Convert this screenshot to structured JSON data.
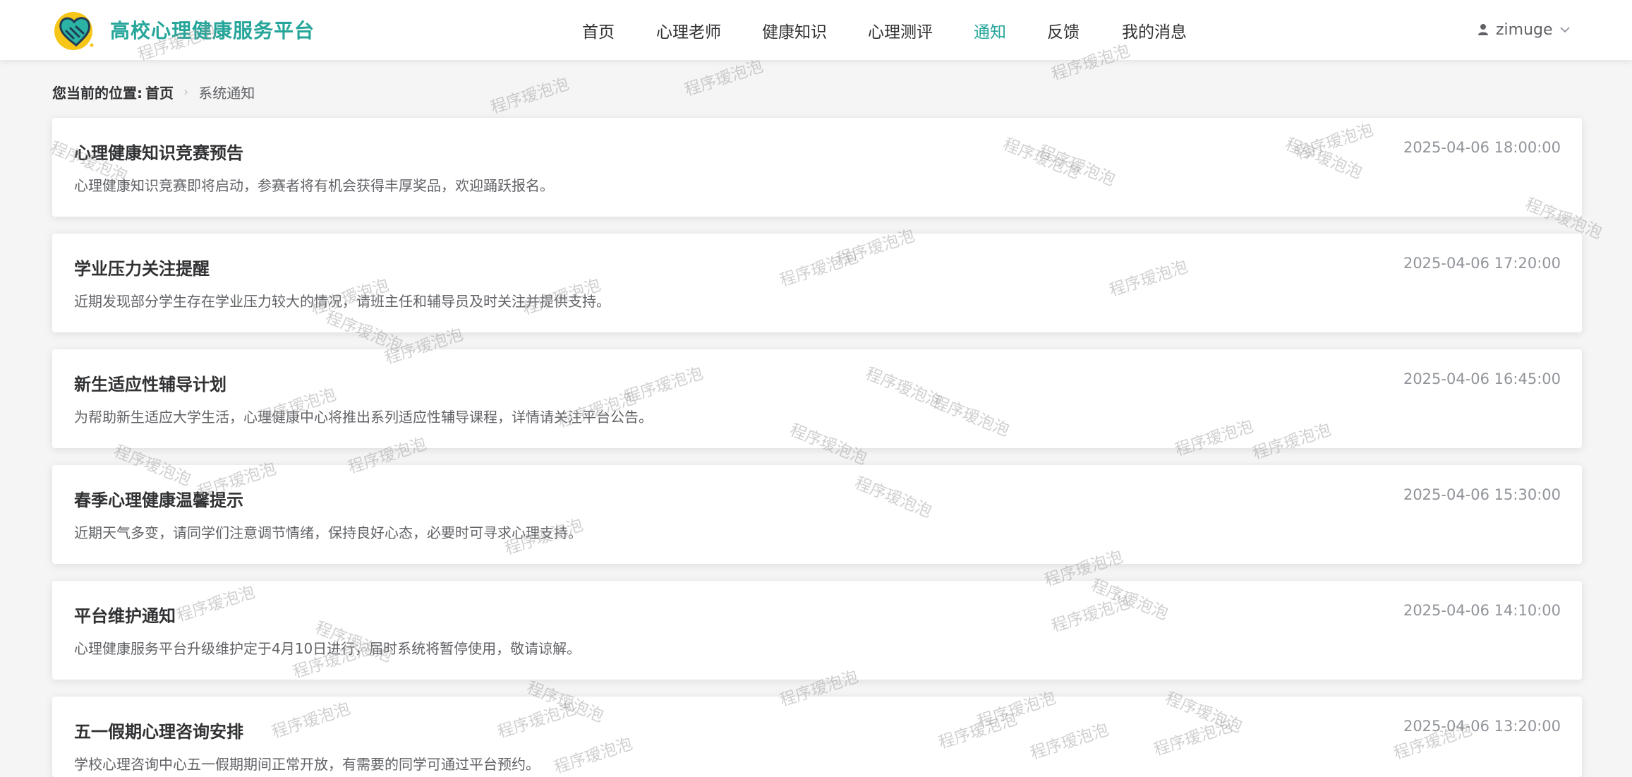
{
  "brand": {
    "name": "高校心理健康服务平台",
    "logo_icon": "heart-hands-logo-icon",
    "colors": {
      "primary": "#26a69a",
      "accent": "#f5c518"
    }
  },
  "nav": {
    "items": [
      "首页",
      "心理老师",
      "健康知识",
      "心理测评",
      "通知",
      "反馈",
      "我的消息"
    ],
    "active": "通知"
  },
  "user": {
    "name": "zimuge",
    "icon": "user-icon",
    "menu_icon": "chevron-down-icon"
  },
  "breadcrumb": {
    "label": "您当前的位置:",
    "home": "首页",
    "current": "系统通知"
  },
  "notices": [
    {
      "title": "心理健康知识竞赛预告",
      "date": "2025-04-06 18:00:00",
      "desc": "心理健康知识竞赛即将启动，参赛者将有机会获得丰厚奖品，欢迎踊跃报名。"
    },
    {
      "title": "学业压力关注提醒",
      "date": "2025-04-06 17:20:00",
      "desc": "近期发现部分学生存在学业压力较大的情况，请班主任和辅导员及时关注并提供支持。"
    },
    {
      "title": "新生适应性辅导计划",
      "date": "2025-04-06 16:45:00",
      "desc": "为帮助新生适应大学生活，心理健康中心将推出系列适应性辅导课程，详情请关注平台公告。"
    },
    {
      "title": "春季心理健康温馨提示",
      "date": "2025-04-06 15:30:00",
      "desc": "近期天气多变，请同学们注意调节情绪，保持良好心态，必要时可寻求心理支持。"
    },
    {
      "title": "平台维护通知",
      "date": "2025-04-06 14:10:00",
      "desc": "心理健康服务平台升级维护定于4月10日进行，届时系统将暂停使用，敬请谅解。"
    },
    {
      "title": "五一假期心理咨询安排",
      "date": "2025-04-06 13:20:00",
      "desc": "学校心理咨询中心五一假期期间正常开放，有需要的同学可通过平台预约。"
    }
  ],
  "watermark": {
    "text": "程序瑷泡泡"
  }
}
